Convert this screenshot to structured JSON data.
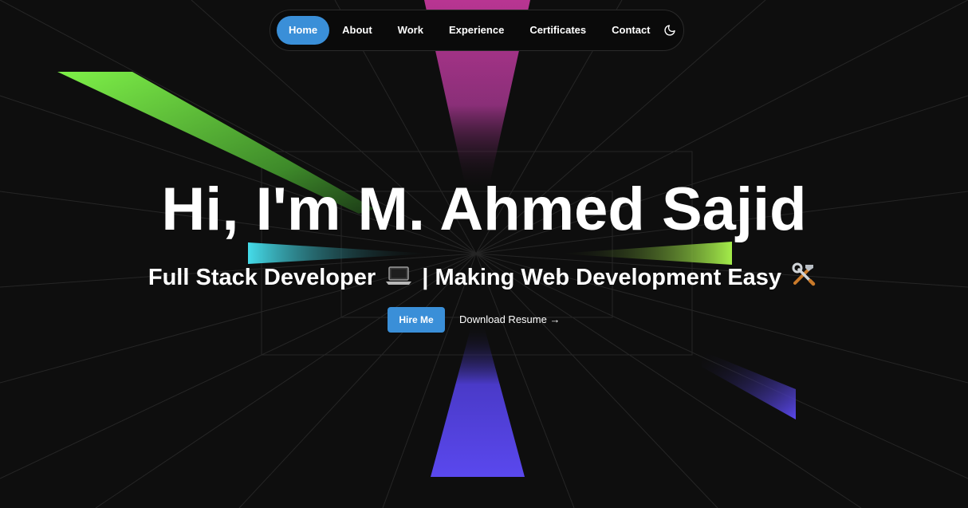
{
  "nav": {
    "items": [
      {
        "label": "Home",
        "active": true
      },
      {
        "label": "About",
        "active": false
      },
      {
        "label": "Work",
        "active": false
      },
      {
        "label": "Experience",
        "active": false
      },
      {
        "label": "Certificates",
        "active": false
      },
      {
        "label": "Contact",
        "active": false
      }
    ],
    "theme_icon": "moon-icon"
  },
  "hero": {
    "title": "Hi, I'm M. Ahmed Sajid",
    "subtitle_part1": "Full Stack Developer",
    "subtitle_part2": "| Making Web Development Easy",
    "subtitle_icon1": "laptop-icon",
    "subtitle_icon2": "tools-icon",
    "hire_label": "Hire Me",
    "resume_label": "Download Resume →"
  },
  "colors": {
    "background": "#0e0e0e",
    "accent": "#3a8fd8",
    "beam_green": "#7be84a",
    "beam_magenta": "#b0378a",
    "beam_cyan": "#3fd4e8",
    "beam_purple": "#5a48e8"
  }
}
